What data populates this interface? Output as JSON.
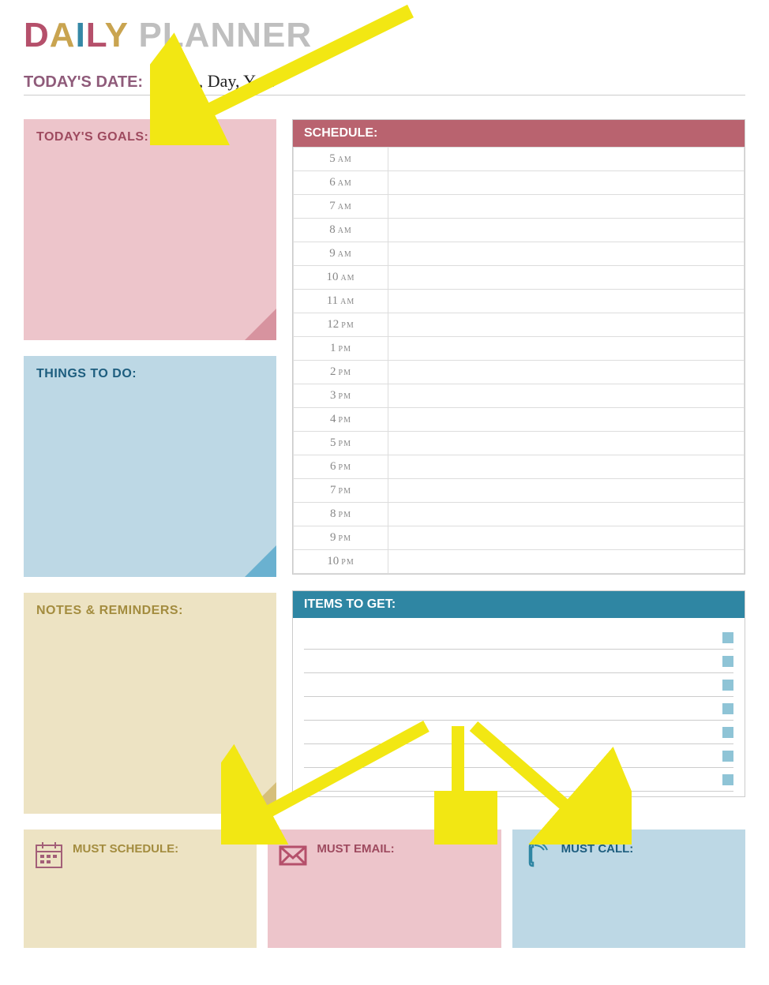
{
  "title": {
    "daily": "DAILY",
    "planner": "PLANNER"
  },
  "date": {
    "label": "TODAY'S DATE:",
    "value": "Month, Day, Year"
  },
  "goals": {
    "header": "TODAY'S GOALS:"
  },
  "todo": {
    "header": "THINGS TO DO:"
  },
  "notes": {
    "header": "NOTES & REMINDERS:"
  },
  "schedule": {
    "header": "SCHEDULE:",
    "times": [
      {
        "num": "5",
        "ampm": "AM"
      },
      {
        "num": "6",
        "ampm": "AM"
      },
      {
        "num": "7",
        "ampm": "AM"
      },
      {
        "num": "8",
        "ampm": "AM"
      },
      {
        "num": "9",
        "ampm": "AM"
      },
      {
        "num": "10",
        "ampm": "AM"
      },
      {
        "num": "11",
        "ampm": "AM"
      },
      {
        "num": "12",
        "ampm": "PM"
      },
      {
        "num": "1",
        "ampm": "PM"
      },
      {
        "num": "2",
        "ampm": "PM"
      },
      {
        "num": "3",
        "ampm": "PM"
      },
      {
        "num": "4",
        "ampm": "PM"
      },
      {
        "num": "5",
        "ampm": "PM"
      },
      {
        "num": "6",
        "ampm": "PM"
      },
      {
        "num": "7",
        "ampm": "PM"
      },
      {
        "num": "8",
        "ampm": "PM"
      },
      {
        "num": "9",
        "ampm": "PM"
      },
      {
        "num": "10",
        "ampm": "PM"
      }
    ]
  },
  "items": {
    "header": "ITEMS TO GET:",
    "count": 7
  },
  "must": {
    "schedule": "MUST SCHEDULE:",
    "email": "MUST EMAIL:",
    "call": "MUST CALL:"
  }
}
